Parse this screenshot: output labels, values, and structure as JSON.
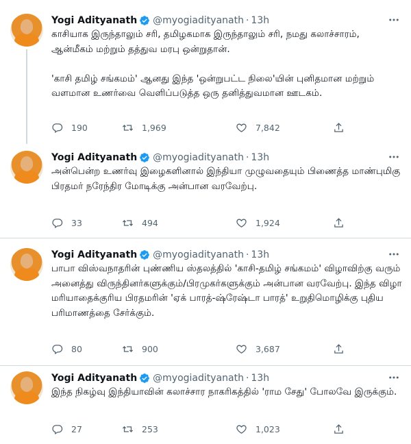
{
  "tweets": [
    {
      "name": "Yogi Adityanath",
      "handle": "@myogiadityanath",
      "time": "13h",
      "text": "காசியாக இருந்தாலும் சரி, தமிழகமாக இருந்தாலும் சரி, நமது கலாச்சாரம், ஆன்மீகம் மற்றும் தத்துவ மரபு ஒன்றுதான்.\n\n'காசி தமிழ் சங்கமம்' ஆனது இந்த 'ஒன்றுபட்ட நிலை'யின் புனிதமான மற்றும் வளமான உணர்வை வெளிப்படுத்த ஒரு தனித்துவமான ஊடகம்.",
      "replies": "190",
      "retweets": "1,969",
      "likes": "7,842"
    },
    {
      "name": "Yogi Adityanath",
      "handle": "@myogiadityanath",
      "time": "13h",
      "text": "அன்பென்ற உணர்வு இழைகளினால் இந்தியா முழுவதையும் பிணைத்த மாண்புமிகு பிரதமர் நரேந்திர மோடிக்கு அன்பான வரவேற்பு.",
      "replies": "33",
      "retweets": "494",
      "likes": "1,924"
    },
    {
      "name": "Yogi Adityanath",
      "handle": "@myogiadityanath",
      "time": "13h",
      "text": "பாபா விஸ்வநாதரின் புண்ணிய ஸ்தலத்தில் 'காசி-தமிழ் சங்கமம்' விழாவிற்கு வரும் அனைத்து விருந்தினர்களுக்கும்/பிரமுகர்களுக்கும் அன்பான வரவேற்பு. இந்த விழா மரியாதைக்குரிய பிரதமரின் 'ஏக் பாரத்-ஷ்ரேஷ்டா பாரத்' உறுதிமொழிக்கு புதிய பரிமாணத்தை சேர்க்கும்.",
      "replies": "80",
      "retweets": "900",
      "likes": "3,687"
    },
    {
      "name": "Yogi Adityanath",
      "handle": "@myogiadityanath",
      "time": "13h",
      "text": "இந்த நிகழ்வு இந்தியாவின் கலாச்சார நாகரிகத்தில் 'ராம சேது' போலவே இருக்கும்.",
      "replies": "27",
      "retweets": "253",
      "likes": "1,023"
    }
  ],
  "colors": {
    "text": "#0f1419",
    "muted": "#536471",
    "verified": "#1d9bf0",
    "divider": "#cfd9de"
  },
  "icons": [
    "verified-badge-icon",
    "more-icon",
    "reply-icon",
    "retweet-icon",
    "like-icon",
    "share-icon"
  ]
}
